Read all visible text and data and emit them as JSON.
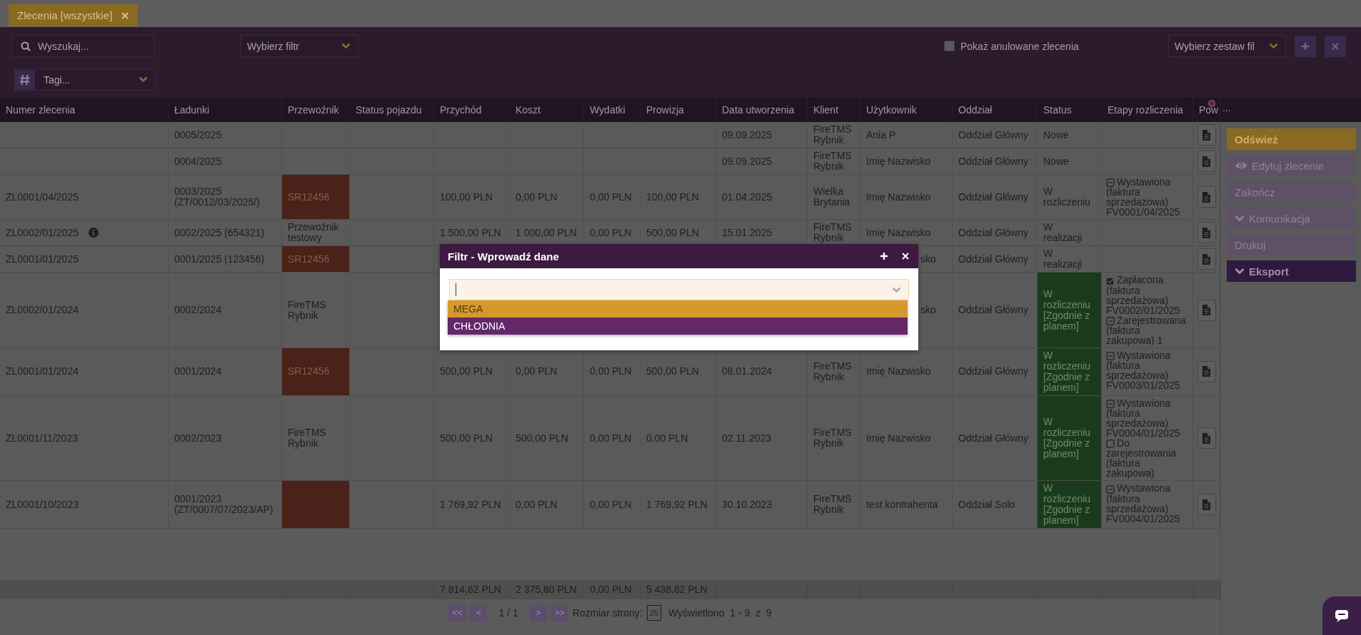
{
  "tabs": [
    {
      "label": "Zlecenia [wszystkie]",
      "selected": true
    }
  ],
  "toolbar": {
    "search": {
      "placeholder": "Wyszukaj..."
    },
    "filter_select": {
      "placeholder": "Wybierz filtr"
    },
    "show_cancelled": {
      "label": "Pokaż anulowane zlecenia",
      "checked": false
    },
    "column_set_select": {
      "placeholder": "Wybierz zestaw fil"
    },
    "tags": {
      "placeholder": "Tagi..."
    }
  },
  "table": {
    "columns": [
      "Numer zlecenia",
      "Ładunki",
      "Przewoźnik",
      "Status pojazdu",
      "Przychód",
      "Koszt",
      "Wydatki",
      "Prowizja",
      "Data utworzenia",
      "Klient",
      "Użytkownik",
      "Oddział",
      "Status",
      "Etapy rozliczenia",
      "Pow"
    ],
    "more_columns": "...",
    "rows": [
      {
        "loads": "0005/2025",
        "info": false,
        "carrier_tag": false,
        "created": "09.09.2025",
        "client": "FireTMS Rybnik",
        "user": "Ania P",
        "user_covered": false,
        "branch": "Oddział Główny",
        "status": "Nowe",
        "on_plan": false
      },
      {
        "loads": "0004/2025",
        "info": false,
        "carrier_tag": false,
        "created": "09.09.2025",
        "client": "FireTMS Rybnik",
        "user": "Imię Nazwisko",
        "user_covered": false,
        "branch": "Oddział Główny",
        "status": "Nowe",
        "on_plan": false
      },
      {
        "number": "ZL0001/04/2025",
        "info": false,
        "loads": "0003/2025 (ZT/0012/03/2025/)",
        "carrier": "SR12456",
        "carrier_tag": true,
        "revenue": "100,00 PLN",
        "cost": "0,00 PLN",
        "expenses": "0,00 PLN",
        "commission": "100,00 PLN",
        "created": "01.04.2025",
        "client": "Wielka Brytania",
        "user": "Imię Nazwisko",
        "user_covered": false,
        "branch": "Oddział Główny",
        "status": "W rozliczeniu",
        "on_plan": false,
        "stages": [
          {
            "kind": "minus",
            "text": "Wystawiona (faktura sprzedażowa) FV0001/04/2025"
          }
        ]
      },
      {
        "number": "ZL0002/01/2025",
        "info": true,
        "loads": "0002/2025 (654321)",
        "carrier": "Przewoźnik testowy",
        "carrier_tag": false,
        "revenue": "1 500,00 PLN",
        "cost": "1 000,00 PLN",
        "expenses": "0,00 PLN",
        "commission": "500,00 PLN",
        "created": "15.01.2025",
        "client": "FireTMS Rybnik",
        "user": "Imię Nazwisko",
        "user_covered": false,
        "branch": "Oddział Główny",
        "status": "W realizacji",
        "on_plan": false
      },
      {
        "number": "ZL0001/01/2025",
        "info": false,
        "loads": "0001/2025 (123456)",
        "carrier": "SR12456",
        "carrier_tag": true,
        "user": "sko",
        "user_covered": true,
        "branch": "Oddział Główny",
        "status": "W realizacji",
        "on_plan": false
      },
      {
        "number": "ZL0002/01/2024",
        "info": false,
        "loads": "0002/2024",
        "carrier": "FireTMS Rybnik",
        "carrier_tag": false,
        "user": "sko",
        "user_covered": true,
        "branch": "Oddział Główny",
        "status": "W rozliczeniu [Zgodnie z planem]",
        "on_plan": true,
        "stages": [
          {
            "kind": "checked",
            "text": "Zapłacona (faktura sprzedażowa) FV0002/01/2025"
          },
          {
            "kind": "minus",
            "text": "Zarejestrowana (faktura zakupowa) 1"
          }
        ]
      },
      {
        "number": "ZL0001/01/2024",
        "info": false,
        "loads": "0001/2024",
        "carrier": "SR12456",
        "carrier_tag": true,
        "revenue": "500,00 PLN",
        "cost": "0,00 PLN",
        "expenses": "0,00 PLN",
        "commission": "500,00 PLN",
        "created": "08.01.2024",
        "client": "FireTMS Rybnik",
        "user": "Imię Nazwisko",
        "user_covered": false,
        "branch": "Oddział Główny",
        "status": "W rozliczeniu [Zgodnie z planem]",
        "on_plan": true,
        "stages": [
          {
            "kind": "minus",
            "text": "Wystawiona (faktura sprzedażowa) FV0003/01/2025"
          }
        ]
      },
      {
        "number": "ZL0001/11/2023",
        "info": false,
        "loads": "0002/2023",
        "carrier": "FireTMS Rybnik",
        "carrier_tag": false,
        "revenue": "500,00 PLN",
        "cost": "500,00 PLN",
        "expenses": "0,00 PLN",
        "commission": "0,00 PLN",
        "created": "02.11.2023",
        "client": "FireTMS Rybnik",
        "user": "Imię Nazwisko",
        "user_covered": false,
        "branch": "Oddział Główny",
        "status": "W rozliczeniu [Zgodnie z planem]",
        "on_plan": true,
        "stages": [
          {
            "kind": "minus",
            "text": "Wystawiona (faktura sprzedażowa) FV0004/01/2025"
          },
          {
            "kind": "unchecked",
            "text": "Do zarejestrowania (faktura zakupowa)"
          }
        ]
      },
      {
        "number": "ZL0001/10/2023",
        "info": false,
        "loads": "0001/2023 (ZT/0007/07/2023/AP)",
        "carrier_tag": true,
        "revenue": "1 769,92 PLN",
        "cost": "0,00 PLN",
        "expenses": "0,00 PLN",
        "commission": "1 769,92 PLN",
        "created": "30.10.2023",
        "client": "FireTMS Rybnik",
        "user": "test kontrahenta",
        "user_covered": false,
        "branch": "Oddział Solo",
        "status": "W rozliczeniu [Zgodnie z planem]",
        "on_plan": true,
        "stages": [
          {
            "kind": "minus",
            "text": "Wystawiona (faktura sprzedażowa) FV0004/01/2025"
          }
        ]
      }
    ],
    "totals": {
      "revenue": "7 814,62 PLN",
      "cost": "2 375,80 PLN",
      "expenses": "0,00 PLN",
      "commission": "5 438,82 PLN"
    }
  },
  "pagination": {
    "first": "<<",
    "prev": "<",
    "page": "1 / 1",
    "next": ">",
    "last": ">>",
    "page_size_label": "Rozmiar strony:",
    "page_size": "25",
    "summary": "Wyświetlono  1 - 9  z  9"
  },
  "side_panel": {
    "buttons": [
      {
        "label": "Odśwież",
        "kind": "primary"
      },
      {
        "label": "Edytuj zlecenie",
        "kind": "view"
      },
      {
        "label": "Zakończ",
        "kind": "plain"
      },
      {
        "label": "Komunikacja",
        "kind": "expand"
      },
      {
        "label": "Drukuj",
        "kind": "plain"
      },
      {
        "label": "Eksport",
        "kind": "export"
      }
    ]
  },
  "modal": {
    "title": "Filtr - Wprowadź dane",
    "options": [
      {
        "label": "MEGA",
        "selected": true
      },
      {
        "label": "CHŁODNIA",
        "selected": false
      }
    ]
  }
}
